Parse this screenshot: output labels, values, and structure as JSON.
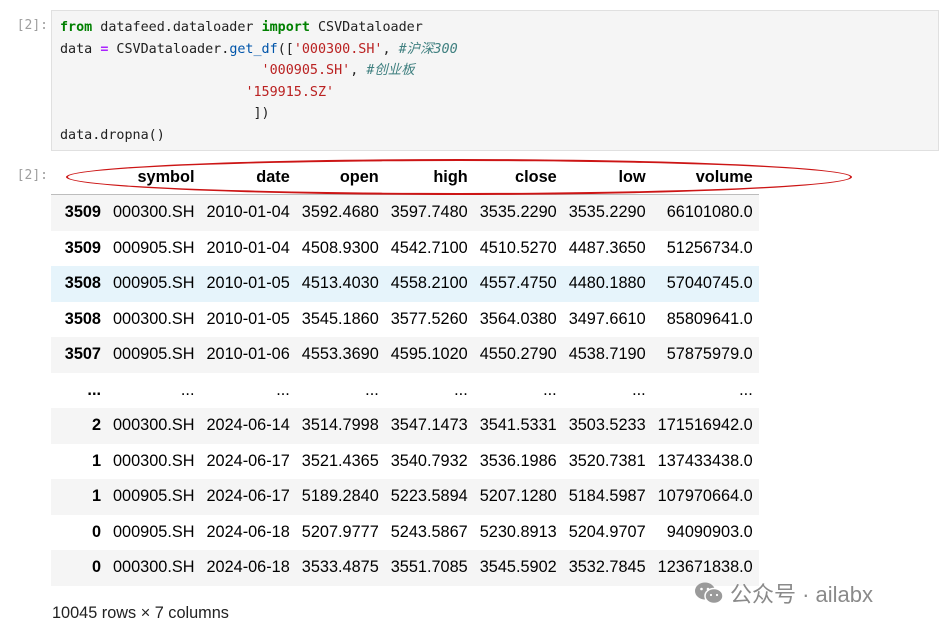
{
  "cells": {
    "input_prompt": "[2]:",
    "output_prompt": "[2]:"
  },
  "code": {
    "l1": {
      "kw_from": "from",
      "module": " datafeed.dataloader ",
      "kw_import": "import",
      "cls": " CSVDataloader"
    },
    "l2": {
      "var": "data ",
      "eq": "=",
      "mid": " CSVDataloader.",
      "fn": "get_df",
      "open": "([",
      "str": "'000300.SH'",
      "comma": ", ",
      "comment": "#沪深300"
    },
    "l3": {
      "indent": "                         ",
      "str": "'000905.SH'",
      "comma": ", ",
      "comment": "#创业板"
    },
    "l4": {
      "indent": "                       ",
      "str": "'159915.SZ'"
    },
    "l5": {
      "indent": "                        ",
      "close": "])"
    },
    "l6": {
      "text": "data.dropna()"
    }
  },
  "table": {
    "columns": [
      "",
      "symbol",
      "date",
      "open",
      "high",
      "close",
      "low",
      "volume"
    ],
    "rows": [
      {
        "index": "3509",
        "symbol": "000300.SH",
        "date": "2010-01-04",
        "open": "3592.4680",
        "high": "3597.7480",
        "close": "3535.2290",
        "low": "3535.2290",
        "volume": "66101080.0"
      },
      {
        "index": "3509",
        "symbol": "000905.SH",
        "date": "2010-01-04",
        "open": "4508.9300",
        "high": "4542.7100",
        "close": "4510.5270",
        "low": "4487.3650",
        "volume": "51256734.0"
      },
      {
        "index": "3508",
        "symbol": "000905.SH",
        "date": "2010-01-05",
        "open": "4513.4030",
        "high": "4558.2100",
        "close": "4557.4750",
        "low": "4480.1880",
        "volume": "57040745.0"
      },
      {
        "index": "3508",
        "symbol": "000300.SH",
        "date": "2010-01-05",
        "open": "3545.1860",
        "high": "3577.5260",
        "close": "3564.0380",
        "low": "3497.6610",
        "volume": "85809641.0"
      },
      {
        "index": "3507",
        "symbol": "000905.SH",
        "date": "2010-01-06",
        "open": "4553.3690",
        "high": "4595.1020",
        "close": "4550.2790",
        "low": "4538.7190",
        "volume": "57875979.0"
      },
      {
        "index": "...",
        "symbol": "...",
        "date": "...",
        "open": "...",
        "high": "...",
        "close": "...",
        "low": "...",
        "volume": "..."
      },
      {
        "index": "2",
        "symbol": "000300.SH",
        "date": "2024-06-14",
        "open": "3514.7998",
        "high": "3547.1473",
        "close": "3541.5331",
        "low": "3503.5233",
        "volume": "171516942.0"
      },
      {
        "index": "1",
        "symbol": "000300.SH",
        "date": "2024-06-17",
        "open": "3521.4365",
        "high": "3540.7932",
        "close": "3536.1986",
        "low": "3520.7381",
        "volume": "137433438.0"
      },
      {
        "index": "1",
        "symbol": "000905.SH",
        "date": "2024-06-17",
        "open": "5189.2840",
        "high": "5223.5894",
        "close": "5207.1280",
        "low": "5184.5987",
        "volume": "107970664.0"
      },
      {
        "index": "0",
        "symbol": "000905.SH",
        "date": "2024-06-18",
        "open": "5207.9777",
        "high": "5243.5867",
        "close": "5230.8913",
        "low": "5204.9707",
        "volume": "94090903.0"
      },
      {
        "index": "0",
        "symbol": "000300.SH",
        "date": "2024-06-18",
        "open": "3533.4875",
        "high": "3551.7085",
        "close": "3545.5902",
        "low": "3532.7845",
        "volume": "123671838.0"
      }
    ],
    "hover_row": 2,
    "footer": "10045 rows × 7 columns"
  },
  "annotation": {
    "color": "#cc1515",
    "shape": "ellipse around header row"
  },
  "watermark": {
    "icon": "wechat-icon",
    "text": "公众号 · ailabx"
  }
}
